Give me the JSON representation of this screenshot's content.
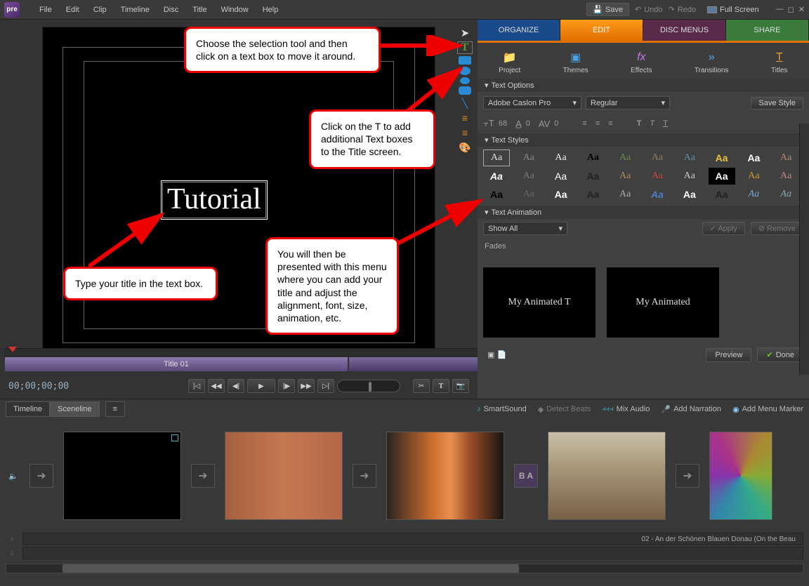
{
  "menubar": {
    "logo": "pre",
    "items": [
      "File",
      "Edit",
      "Clip",
      "Timeline",
      "Disc",
      "Title",
      "Window",
      "Help"
    ],
    "save": "Save",
    "undo": "Undo",
    "redo": "Redo",
    "fullscreen": "Full Screen"
  },
  "monitor": {
    "title_text": "Tutorial"
  },
  "mini_timeline": {
    "clip_label": "Title 01"
  },
  "transport": {
    "timecode": "00;00;00;00"
  },
  "annotations": {
    "a1": "Choose the selection tool and then click on a text box to move it around.",
    "a2": "Click on the T to add additional Text boxes to the Title screen.",
    "a3": "You will then be presented with this menu where you can add your title and adjust the alignment, font, size, animation, etc.",
    "a4": "Type your title in the text box."
  },
  "tabs": {
    "organize": "ORGANIZE",
    "edit": "EDIT",
    "disc": "DISC MENUS",
    "share": "SHARE"
  },
  "subtabs": {
    "project": "Project",
    "themes": "Themes",
    "effects": "Effects",
    "transitions": "Transitions",
    "titles": "Titles"
  },
  "text_options": {
    "header": "Text Options",
    "font": "Adobe Caslon Pro",
    "weight": "Regular",
    "save_style": "Save Style",
    "size": "68",
    "leading": "0",
    "kerning": "0"
  },
  "text_styles": {
    "header": "Text Styles",
    "sample": "Aa"
  },
  "text_animation": {
    "header": "Text Animation",
    "filter": "Show All",
    "apply": "Apply",
    "remove": "Remove",
    "category": "Fades",
    "preview1": "My Animated T",
    "preview2": "My Animated"
  },
  "done_row": {
    "preview": "Preview",
    "done": "Done"
  },
  "bottom": {
    "timeline": "Timeline",
    "sceneline": "Sceneline",
    "smartsound": "SmartSound",
    "detect_beats": "Detect Beats",
    "mix_audio": "Mix Audio",
    "add_narration": "Add Narration",
    "add_menu_marker": "Add Menu Marker",
    "audio_track": "02 - An der Schönen Blauen Donau (On the Beau"
  },
  "style_variants": [
    {
      "ff": "serif",
      "c": "#ddd",
      "bg": ""
    },
    {
      "ff": "serif",
      "c": "#888",
      "bg": ""
    },
    {
      "ff": "serif",
      "c": "#eee",
      "bg": ""
    },
    {
      "ff": "serif",
      "c": "#000",
      "bg": "",
      "fw": "bold"
    },
    {
      "ff": "cursive",
      "c": "#6a8a4a",
      "bg": ""
    },
    {
      "ff": "serif",
      "c": "#8a7a5a",
      "bg": ""
    },
    {
      "ff": "serif",
      "c": "#5a8aaa",
      "bg": ""
    },
    {
      "ff": "sans-serif",
      "c": "#e8c040",
      "bg": "",
      "fw": "bold"
    },
    {
      "ff": "sans-serif",
      "c": "#fff",
      "bg": "",
      "fw": "bold"
    },
    {
      "ff": "serif",
      "c": "#aa8866",
      "bg": ""
    },
    {
      "ff": "sans-serif",
      "c": "#fff",
      "bg": "",
      "fw": "bold",
      "fs": "italic"
    },
    {
      "ff": "serif",
      "c": "#777",
      "bg": ""
    },
    {
      "ff": "sans-serif",
      "c": "#fff",
      "bg": ""
    },
    {
      "ff": "sans-serif",
      "c": "#222",
      "bg": "",
      "fw": "bold"
    },
    {
      "ff": "cursive",
      "c": "#a86",
      "bg": ""
    },
    {
      "ff": "cursive",
      "c": "#c44",
      "bg": ""
    },
    {
      "ff": "serif",
      "c": "#ccc",
      "bg": ""
    },
    {
      "ff": "sans-serif",
      "c": "#fff",
      "bg": "#000",
      "fw": "bold"
    },
    {
      "ff": "serif",
      "c": "#cc9933",
      "bg": ""
    },
    {
      "ff": "serif",
      "c": "#b88",
      "bg": ""
    },
    {
      "ff": "sans-serif",
      "c": "#000",
      "bg": "",
      "fw": "900"
    },
    {
      "ff": "serif",
      "c": "#666",
      "bg": ""
    },
    {
      "ff": "sans-serif",
      "c": "#fff",
      "bg": "",
      "fw": "bold"
    },
    {
      "ff": "sans-serif",
      "c": "#222",
      "bg": "",
      "fw": "bold"
    },
    {
      "ff": "serif",
      "c": "#aaa",
      "bg": ""
    },
    {
      "ff": "sans-serif",
      "c": "#4a7ac8",
      "bg": "",
      "fs": "italic",
      "fw": "bold"
    },
    {
      "ff": "sans-serif",
      "c": "#fff",
      "bg": "",
      "fw": "900"
    },
    {
      "ff": "sans-serif",
      "c": "#222",
      "bg": "",
      "fw": "bold"
    },
    {
      "ff": "serif",
      "c": "#7aa8d8",
      "bg": "",
      "fs": "italic"
    },
    {
      "ff": "cursive",
      "c": "#8ab",
      "bg": "",
      "fs": "italic"
    }
  ]
}
